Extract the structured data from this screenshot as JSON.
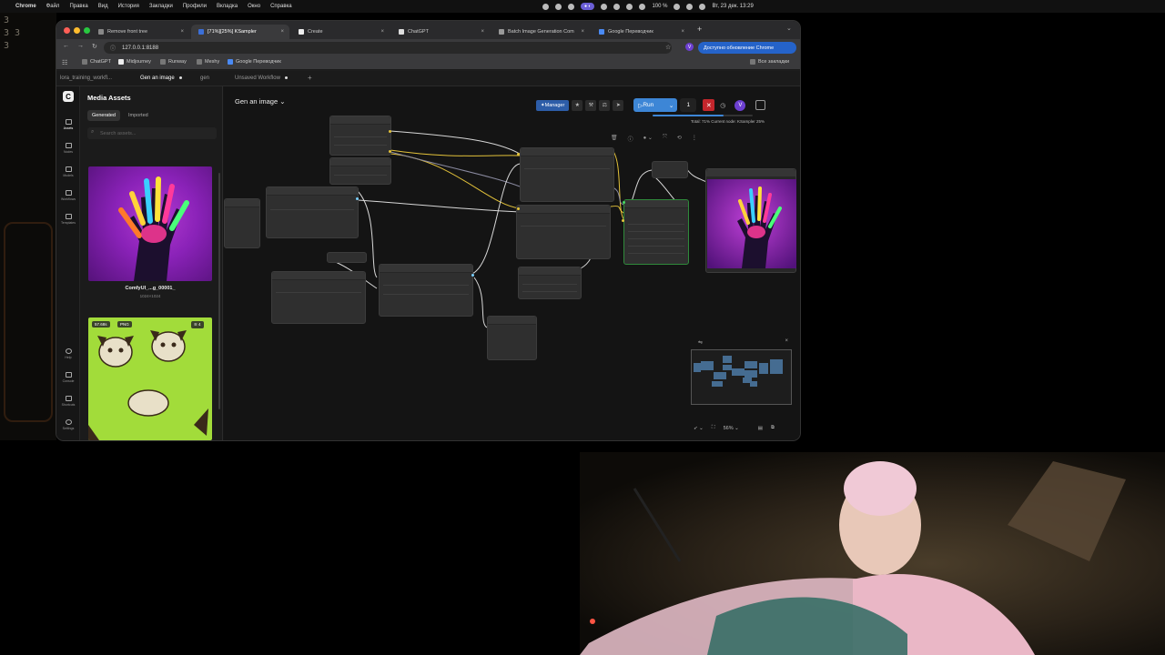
{
  "menubar": {
    "app": "Chrome",
    "items": [
      "Файл",
      "Правка",
      "Вид",
      "История",
      "Закладки",
      "Профили",
      "Вкладка",
      "Окно",
      "Справка"
    ],
    "battery": "100 %",
    "clock": "Вт, 23 дек. 13:29"
  },
  "bg_numbers": [
    "3",
    "3  3",
    "3"
  ],
  "browser": {
    "tabs": [
      {
        "label": "Remove front tree"
      },
      {
        "label": "[71%][25%] KSampler"
      },
      {
        "label": "Create"
      },
      {
        "label": "ChatGPT"
      },
      {
        "label": "Batch Image Generation Com"
      },
      {
        "label": "Google Переводчик"
      }
    ],
    "url": "127.0.0.1:8188",
    "profile_initial": "V",
    "update_label": "Доступно обновление Chrome",
    "bookmarks": [
      "ChatGPT",
      "Midjourney",
      "Runway",
      "Meshy",
      "Google Переводчик"
    ],
    "all_bookmarks": "Все закладки"
  },
  "app": {
    "workflow_tabs": [
      "lora_training_workfl...",
      "Gen an image",
      "gen",
      "Unsaved Workflow"
    ],
    "rail": [
      "Assets",
      "Nodes",
      "Models",
      "Workflows",
      "Templates",
      "Help",
      "Console",
      "Shortcuts",
      "Settings"
    ],
    "assets": {
      "title": "Media Assets",
      "tab_generated": "Generated",
      "tab_imported": "Imported",
      "search_placeholder": "Search assets...",
      "item1_name": "ComfyUI_...g_00001_",
      "item1_dims": "1024×1024",
      "item2_time": "57.68s",
      "item2_format": "PNG",
      "item2_count": "4"
    },
    "canvas": {
      "workflow_name": "Gen an image",
      "manager_label": "Manager",
      "run_label": "Run",
      "run_count": "1",
      "progress_text": "Total: 71%   Current node: KSampler 25%",
      "progress_total": 0.71,
      "zoom": "56%"
    }
  },
  "colors": {
    "run_blue": "#3d86d6",
    "cancel_red": "#c3262c",
    "profile_purple": "#6c3fd0",
    "wire_yellow": "#e3c23a",
    "wire_white": "#d8d8d8"
  }
}
